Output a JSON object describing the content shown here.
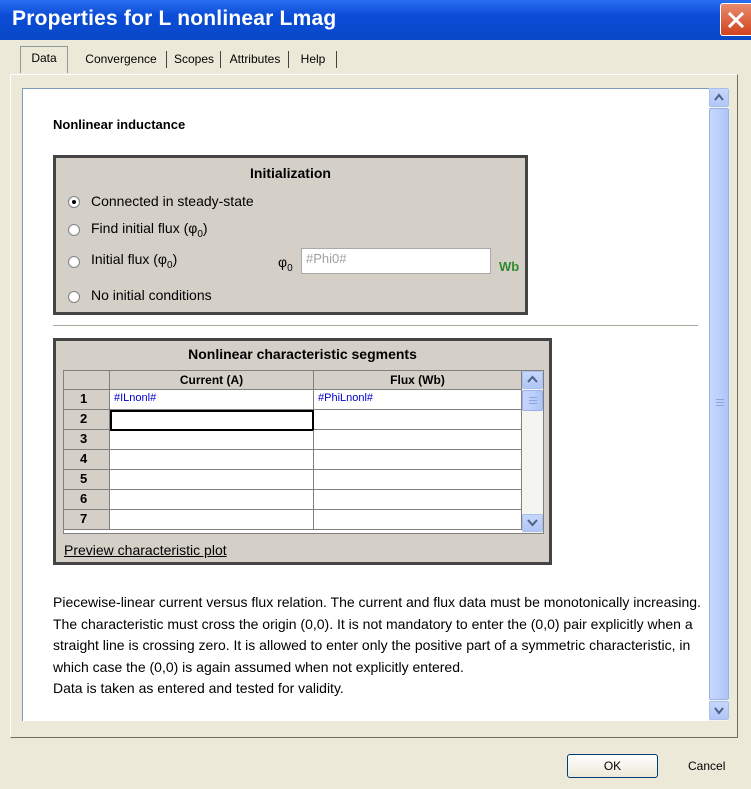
{
  "window": {
    "title": "Properties for L nonlinear Lmag"
  },
  "tabs": [
    "Data",
    "Convergence",
    "Scopes",
    "Attributes",
    "Help"
  ],
  "section_title": "Nonlinear inductance",
  "initialization": {
    "title": "Initialization",
    "options": [
      {
        "label": "Connected in steady-state",
        "selected": true
      },
      {
        "label": "Find initial flux (φ",
        "sub": "0",
        "tail": ")",
        "selected": false
      },
      {
        "label": "Initial flux (φ",
        "sub": "0",
        "tail": ")",
        "selected": false
      },
      {
        "label": "No initial conditions",
        "selected": false
      }
    ],
    "phi0_symbol": "φ",
    "phi0_sub": "0",
    "phi0_value": "#Phi0#",
    "phi0_unit": "Wb"
  },
  "segments": {
    "title": "Nonlinear characteristic segments",
    "columns": [
      "Current (A)",
      "Flux (Wb)"
    ],
    "row_numbers": [
      "1",
      "2",
      "3",
      "4",
      "5",
      "6",
      "7"
    ],
    "rows": [
      {
        "current": "#ILnonl#",
        "flux": "#PhiLnonl#"
      },
      {
        "current": "",
        "flux": ""
      },
      {
        "current": "",
        "flux": ""
      },
      {
        "current": "",
        "flux": ""
      },
      {
        "current": "",
        "flux": ""
      },
      {
        "current": "",
        "flux": ""
      },
      {
        "current": "",
        "flux": ""
      }
    ],
    "preview_link": "Preview characteristic plot"
  },
  "description": {
    "paragraph": "Piecewise-linear current versus flux relation. The current and flux data must be monotonically increasing. The characteristic must cross the origin (0,0). It is not mandatory to enter the (0,0) pair explicitly when a straight line is crossing zero. It is allowed to enter only the positive part of a symmetric characteristic, in which case the (0,0) is again assumed when not explicitly entered.",
    "note": "Data is taken as entered and tested for validity."
  },
  "buttons": {
    "ok": "OK",
    "cancel": "Cancel"
  },
  "colors": {
    "titlebar": "#0a4cd6",
    "unit_text": "#2f8a2f",
    "cell_text": "#0000cc"
  }
}
